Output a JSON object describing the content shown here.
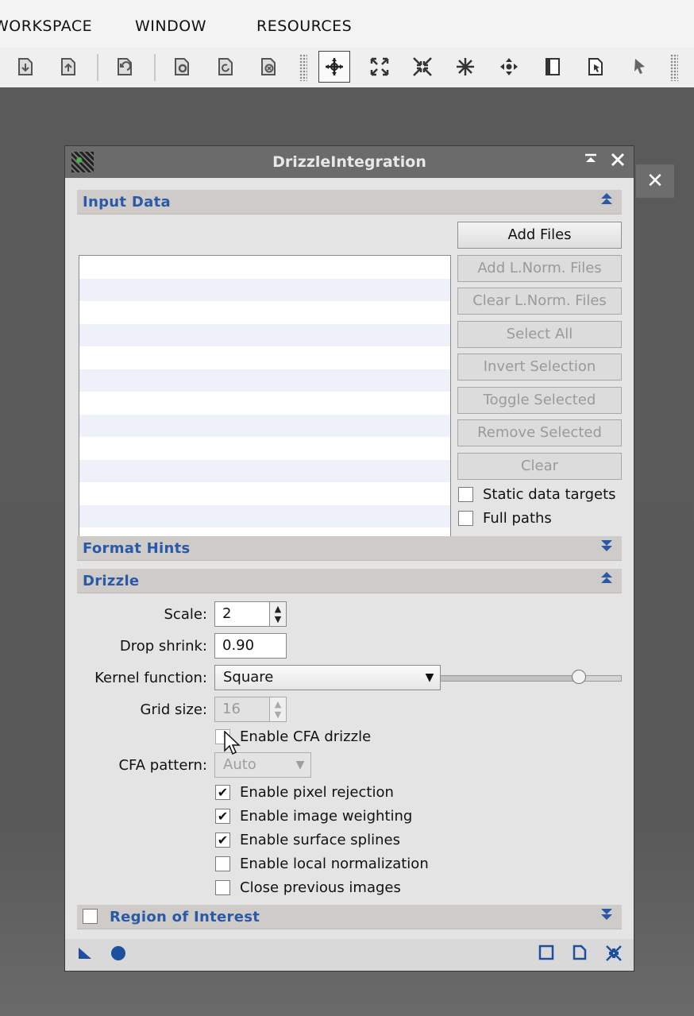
{
  "menubar": {
    "items": [
      "WORKSPACE",
      "WINDOW",
      "RESOURCES"
    ]
  },
  "toolbar": {
    "icons": [
      "doc-down-icon",
      "doc-up-icon",
      "undo-doc-icon",
      "gear-doc-icon",
      "refresh-doc-icon",
      "close-doc-icon",
      "move-icon",
      "expand-icon",
      "collapse-icon",
      "snowflake-icon",
      "pan-icon",
      "page-icon",
      "zoom-page-icon",
      "pointer-icon"
    ],
    "active_icon": "move-icon"
  },
  "side_close_label": "✕",
  "dialog": {
    "title": "DrizzleIntegration",
    "sections": {
      "input_data": "Input Data",
      "format_hints": "Format Hints",
      "drizzle": "Drizzle",
      "roi": "Region of Interest"
    },
    "buttons": {
      "add_files": "Add Files",
      "add_lnorm": "Add L.Norm. Files",
      "clear_lnorm": "Clear L.Norm. Files",
      "select_all": "Select All",
      "invert_selection": "Invert Selection",
      "toggle_selected": "Toggle Selected",
      "remove_selected": "Remove Selected",
      "clear": "Clear"
    },
    "input_options": {
      "static_data_targets": {
        "label": "Static data targets",
        "checked": false
      },
      "full_paths": {
        "label": "Full paths",
        "checked": false
      }
    },
    "drizzle": {
      "scale_label": "Scale:",
      "scale_value": "2",
      "drop_shrink_label": "Drop shrink:",
      "drop_shrink_value": "0.90",
      "drop_shrink_slider": 0.9,
      "kernel_label": "Kernel function:",
      "kernel_value": "Square",
      "grid_label": "Grid size:",
      "grid_value": "16",
      "cfa_drizzle": {
        "label": "Enable CFA drizzle",
        "checked": false
      },
      "cfa_pattern_label": "CFA pattern:",
      "cfa_pattern_value": "Auto",
      "pixel_rejection": {
        "label": "Enable pixel rejection",
        "checked": true
      },
      "image_weighting": {
        "label": "Enable image weighting",
        "checked": true
      },
      "surface_splines": {
        "label": "Enable surface splines",
        "checked": true
      },
      "local_normalization": {
        "label": "Enable local normalization",
        "checked": false
      },
      "close_previous": {
        "label": "Close previous images",
        "checked": false
      }
    },
    "roi_checked": false
  },
  "colors": {
    "section_title": "#2a5aa7",
    "titlebar": "#6b6b6b",
    "workspace": "#5a5a5a"
  }
}
